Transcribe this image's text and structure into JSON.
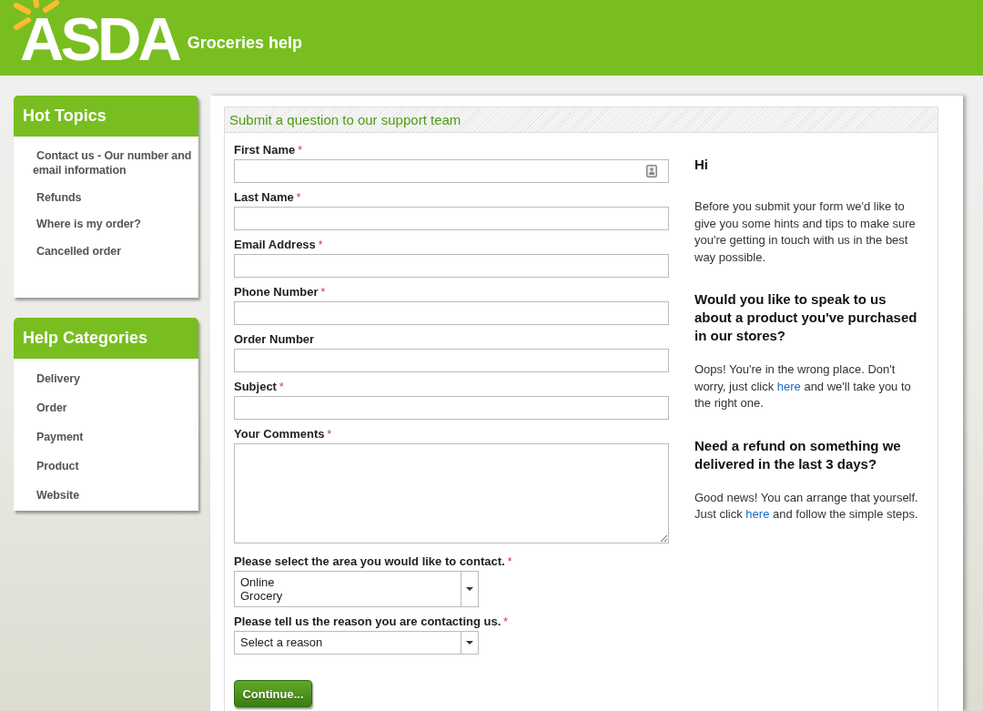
{
  "header": {
    "logo": "ASDA",
    "title": "Groceries help"
  },
  "sidebar": [
    {
      "title": "Hot Topics",
      "items": [
        "Contact us - Our number and email information",
        "Refunds",
        "Where is my order?",
        "Cancelled order"
      ]
    },
    {
      "title": "Help Categories",
      "items": [
        "Delivery",
        "Order",
        "Payment",
        "Product",
        "Website"
      ]
    }
  ],
  "form": {
    "title": "Submit a question to our support team",
    "fields": [
      {
        "kind": "text",
        "label": "First Name",
        "required_mark": "*",
        "autofill_icon": true
      },
      {
        "kind": "text",
        "label": "Last Name",
        "required_mark": "*",
        "autofill_icon": false
      },
      {
        "kind": "text",
        "label": "Email Address",
        "required_mark": "*",
        "autofill_icon": false
      },
      {
        "kind": "text",
        "label": "Phone Number",
        "required_mark": "*",
        "autofill_icon": false
      },
      {
        "kind": "text",
        "label": "Order Number",
        "autofill_icon": false
      },
      {
        "kind": "text",
        "label": "Subject",
        "required_mark": "*",
        "autofill_icon": false
      },
      {
        "kind": "textarea",
        "label": "Your Comments",
        "required_mark": "*"
      },
      {
        "kind": "select",
        "label": "Please select the area you would like to contact.",
        "required_mark": "*",
        "value": "Online\nGrocery"
      },
      {
        "kind": "select",
        "label": "Please tell us the reason you are contacting us.",
        "required_mark": "*",
        "value": "Select a reason"
      }
    ],
    "submit": "Continue..."
  },
  "info": [
    {
      "kind": "heading",
      "text": "Hi"
    },
    {
      "kind": "paragraph",
      "parts": [
        {
          "kind": "text",
          "text": "Before you submit your form we'd like to give you some hints and tips to make sure you're getting in touch with us in the best way possible."
        }
      ]
    },
    {
      "kind": "heading",
      "text": "Would you like to speak to us about a product you've purchased in our stores?"
    },
    {
      "kind": "paragraph",
      "parts": [
        {
          "kind": "text",
          "text": "Oops! You're in the wrong place. Don't worry, just click "
        },
        {
          "kind": "link",
          "text": "here"
        },
        {
          "kind": "text",
          "text": " and we'll take you to the right one."
        }
      ]
    },
    {
      "kind": "heading",
      "text": "Need a refund on something we delivered in the last 3 days?"
    },
    {
      "kind": "paragraph",
      "parts": [
        {
          "kind": "text",
          "text": "Good news! You can arrange that yourself. Just click "
        },
        {
          "kind": "link",
          "text": "here"
        },
        {
          "kind": "text",
          "text": " and follow the simple steps."
        }
      ]
    }
  ]
}
